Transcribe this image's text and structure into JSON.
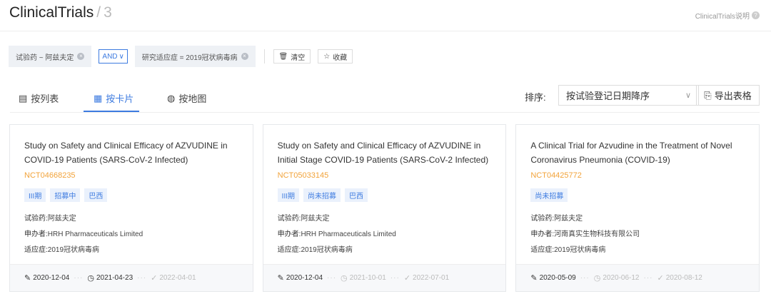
{
  "header": {
    "title": "ClinicalTrials",
    "count": "3",
    "help_text": "ClinicalTrials说明"
  },
  "filters": {
    "chip1": "试验药 ~ 阿兹夫定",
    "operator": "AND",
    "chip2": "研究适应症 = 2019冠状病毒病",
    "clear_label": "清空",
    "save_label": "收藏"
  },
  "tabs": [
    {
      "label": "按列表",
      "icon": "list-icon"
    },
    {
      "label": "按卡片",
      "icon": "grid-icon",
      "active": true
    },
    {
      "label": "按地图",
      "icon": "globe-icon"
    }
  ],
  "sort": {
    "label": "排序:",
    "value": "按试验登记日期降序"
  },
  "export_label": "导出表格",
  "field_labels": {
    "drug": "试验药:",
    "sponsor": "申办者:",
    "indication": "适应症:"
  },
  "cards": [
    {
      "title": "Study on Safety and Clinical Efficacy of AZVUDINE in COVID-19 Patients (SARS-CoV-2 Infected)",
      "nct": "NCT04668235",
      "tags": [
        "III期",
        "招募中",
        "巴西"
      ],
      "drug": "阿兹夫定",
      "sponsor": "HRH Pharmaceuticals Limited",
      "indication": "2019冠状病毒病",
      "dates": [
        "2020-12-04",
        "2021-04-23",
        "2022-04-01"
      ]
    },
    {
      "title": "Study on Safety and Clinical Efficacy of AZVUDINE in Initial Stage COVID-19 Patients (SARS-CoV-2 Infected)",
      "nct": "NCT05033145",
      "tags": [
        "III期",
        "尚未招募",
        "巴西"
      ],
      "drug": "阿兹夫定",
      "sponsor": "HRH Pharmaceuticals Limited",
      "indication": "2019冠状病毒病",
      "dates": [
        "2020-12-04",
        "2021-10-01",
        "2022-07-01"
      ]
    },
    {
      "title": "A Clinical Trial for Azvudine in the Treatment of Novel Coronavirus Pneumonia (COVID-19)",
      "nct": "NCT04425772",
      "tags": [
        "尚未招募"
      ],
      "drug": "阿兹夫定",
      "sponsor": "河南真实生物科技有限公司",
      "indication": "2019冠状病毒病",
      "dates": [
        "2020-05-09",
        "2020-06-12",
        "2020-08-12"
      ]
    }
  ]
}
